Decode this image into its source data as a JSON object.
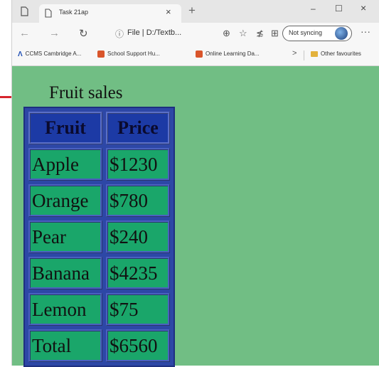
{
  "tab": {
    "title": "Task 21ap",
    "close": "×",
    "new_tab": "+"
  },
  "window_controls": {
    "minimize": "–",
    "maximize": "☐",
    "close": "×"
  },
  "nav": {
    "back": "←",
    "forward": "→",
    "refresh": "↻"
  },
  "address": {
    "info_icon": "ⓘ",
    "text": "File | D:/Textb..."
  },
  "toolbar": {
    "zoom": "⊕",
    "favorite": "☆",
    "favorites_list": "≴",
    "collections": "⊞"
  },
  "sync": {
    "label": "Not syncing"
  },
  "more": "···",
  "favourites": [
    {
      "label": "CCMS Cambridge A...",
      "icon_color": "#1f4fb5"
    },
    {
      "label": "School Support Hu...",
      "icon_color": "#d9552b"
    },
    {
      "label": "Online Learning Da...",
      "icon_color": "#d9552b"
    },
    {
      "label": "Other favourites",
      "icon_color": "#e3b23c"
    }
  ],
  "fav_chevron": ">",
  "page": {
    "title": "Fruit sales",
    "table": {
      "headers": [
        "Fruit",
        "Price"
      ],
      "rows": [
        [
          "Apple",
          "$1230"
        ],
        [
          "Orange",
          "$780"
        ],
        [
          "Pear",
          "$240"
        ],
        [
          "Banana",
          "$4235"
        ],
        [
          "Lemon",
          "$75"
        ],
        [
          "Total",
          "$6560"
        ]
      ]
    }
  },
  "colors": {
    "page_bg": "#71be84",
    "table_border": "#2d47a6",
    "cell_bg": "#1aa66a",
    "header_bg": "#1c3aa5",
    "arrow": "#d6252c"
  }
}
